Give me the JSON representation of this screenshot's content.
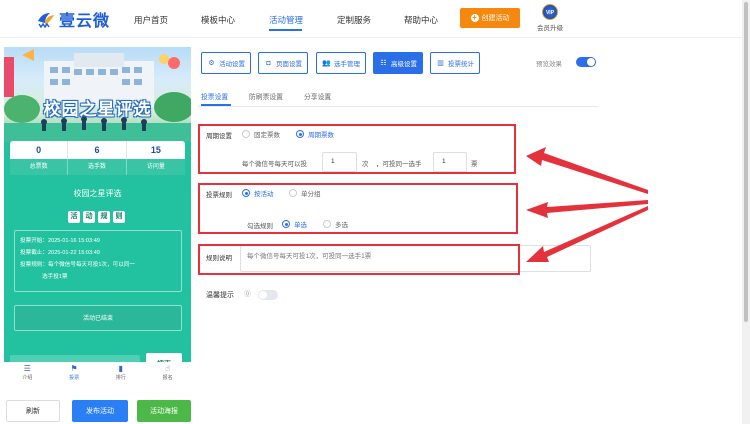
{
  "nav": {
    "brand": "壹云微",
    "links": [
      "用户首页",
      "模板中心",
      "活动管理",
      "定制服务",
      "帮助中心"
    ],
    "create_label": "创建活动",
    "vip_badge": "VIP",
    "vip_label": "会员升级"
  },
  "preview": {
    "banner_title": "校园之星评选",
    "stats": [
      {
        "value": "0",
        "label": "总票数"
      },
      {
        "value": "6",
        "label": "选手数"
      },
      {
        "value": "15",
        "label": "访问量"
      }
    ],
    "activity_title": "校园之星评选",
    "rules_heading_chars": [
      "活",
      "动",
      "规",
      "则"
    ],
    "info_lines": [
      "投票开始：2025-01-16 15:03:49",
      "投票截止：2025-01-22 15:03:49",
      "投票规则：每个微信号每天可投1次，可以同一",
      "选手投1票"
    ],
    "status_text": "活动已结束",
    "search_button": "搜索",
    "bottom_tabs": [
      {
        "icon": "list-icon",
        "label": "介绍"
      },
      {
        "icon": "flag-icon",
        "label": "投票"
      },
      {
        "icon": "chart-icon",
        "label": "排行"
      },
      {
        "icon": "hand-icon",
        "label": "报名"
      }
    ]
  },
  "actions": {
    "refresh": "刷新",
    "publish": "发布活动",
    "poster": "活动海报"
  },
  "settings": {
    "top_buttons": [
      "活动设置",
      "页面设置",
      "选手管理",
      "高级设置",
      "投票统计"
    ],
    "active_top_button": "高级设置",
    "preview_effect_label": "预览效果",
    "preview_effect_on": true,
    "subtabs": [
      "投票设置",
      "防刷票设置",
      "分享设置"
    ],
    "active_subtab": "投票设置",
    "cycle": {
      "label": "周期设置",
      "options": [
        "固定票数",
        "周期票数"
      ],
      "selected": "周期票数",
      "daily_prefix": "每个微信号每天可以投",
      "daily_value": "1",
      "unit_times": "次",
      "same_prefix": "，可投同一选手",
      "same_value": "1",
      "unit_votes": "票"
    },
    "vote_rule": {
      "label": "投票规则",
      "options": [
        "按活动",
        "单分组"
      ],
      "selected": "按活动",
      "check_label": "勾选规则",
      "check_options": [
        "单选",
        "多选"
      ],
      "check_selected": "单选"
    },
    "rule_desc": {
      "label": "规则说明",
      "placeholder": "每个微信号每天可投1次，可投同一选手1票"
    },
    "tip": {
      "label": "温馨提示",
      "on": false
    }
  }
}
